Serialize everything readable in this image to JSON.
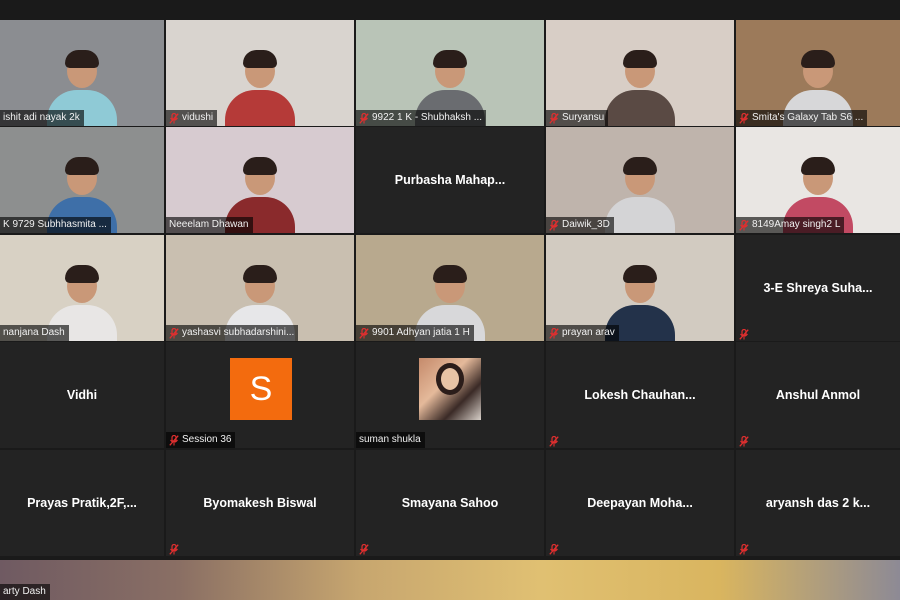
{
  "participants": [
    {
      "name": "ishit adi nayak 2k",
      "muted": false,
      "mode": "video",
      "bg": "#8b8d91",
      "shirt": "#8fcad6"
    },
    {
      "name": "vidushi",
      "muted": true,
      "mode": "video",
      "bg": "#d9d4cf",
      "shirt": "#b53a38"
    },
    {
      "name": "9922 1 K - Shubhaksh ...",
      "muted": true,
      "mode": "video",
      "bg": "#b9c4b7",
      "shirt": "#6a6c70"
    },
    {
      "name": "Suryansu",
      "muted": true,
      "mode": "video",
      "bg": "#d8cec6",
      "shirt": "#5a4a44"
    },
    {
      "name": "Smita's Galaxy Tab S6 ...",
      "muted": true,
      "mode": "video",
      "bg": "#9c7a5a",
      "shirt": "#d7d7d9"
    },
    {
      "name": "K 9729 Subhhasmita ...",
      "muted": false,
      "mode": "video",
      "bg": "#8d8f8f",
      "shirt": "#3e6fa8"
    },
    {
      "name": "Neeelam Dhawan",
      "muted": false,
      "mode": "video",
      "bg": "#d7cbd0",
      "shirt": "#8a2a2c"
    },
    {
      "name": "Purbasha  Mahap...",
      "muted": false,
      "mode": "name"
    },
    {
      "name": "Daiwik_3D",
      "muted": true,
      "mode": "video",
      "bg": "#bfb4ac",
      "shirt": "#d4d4d6"
    },
    {
      "name": "8149Amay singh2 L",
      "muted": true,
      "mode": "video",
      "bg": "#e9e6e3",
      "shirt": "#c24a63"
    },
    {
      "name": "nanjana Dash",
      "muted": false,
      "mode": "video",
      "bg": "#d8d1c4",
      "shirt": "#e8e6e5"
    },
    {
      "name": "yashasvi subhadarshini...",
      "muted": true,
      "mode": "video",
      "bg": "#c9bfb0",
      "shirt": "#e7e7e9"
    },
    {
      "name": "9901 Adhyan jatia 1 H",
      "muted": true,
      "mode": "video",
      "bg": "#b8a98e",
      "shirt": "#d8d8da"
    },
    {
      "name": "prayan arav",
      "muted": true,
      "mode": "video",
      "bg": "#d2cbc1",
      "shirt": "#23324a"
    },
    {
      "name": "3-E  Shreya  Suha...",
      "muted": true,
      "mode": "name"
    },
    {
      "name": "Vidhi",
      "muted": false,
      "mode": "name"
    },
    {
      "name": "Session 36",
      "muted": true,
      "mode": "session",
      "letter": "S"
    },
    {
      "name": "suman shukla",
      "muted": false,
      "mode": "photo"
    },
    {
      "name": "Lokesh  Chauhan...",
      "muted": true,
      "mode": "name"
    },
    {
      "name": "Anshul Anmol",
      "muted": true,
      "mode": "name"
    },
    {
      "name": "Prayas  Pratik,2F,...",
      "muted": false,
      "mode": "name"
    },
    {
      "name": "Byomakesh Biswal",
      "muted": true,
      "mode": "name"
    },
    {
      "name": "Smayana Sahoo",
      "muted": true,
      "mode": "name"
    },
    {
      "name": "Deepayan  Moha...",
      "muted": true,
      "mode": "name"
    },
    {
      "name": "aryansh das 2 k...",
      "muted": true,
      "mode": "name"
    }
  ],
  "active_speaker": {
    "name": "arty Dash"
  },
  "colors": {
    "mute_icon": "#e02f2f",
    "session_avatar": "#f36b0e",
    "tile_bg": "#232323"
  }
}
